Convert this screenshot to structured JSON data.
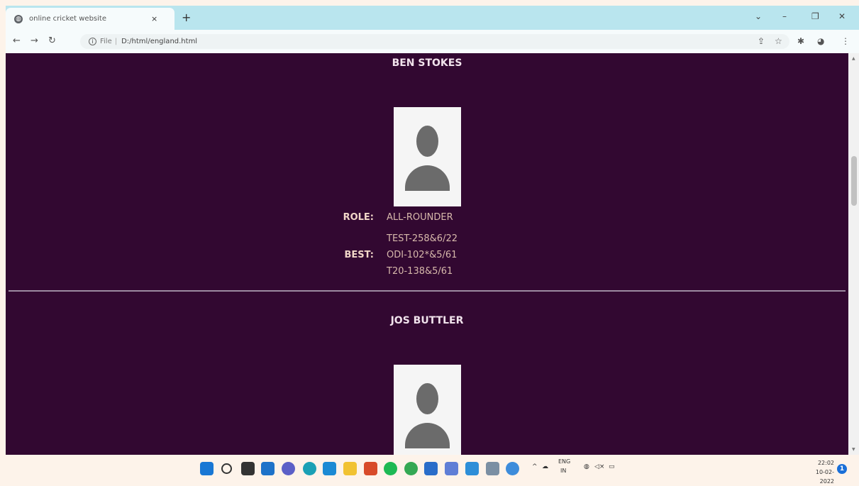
{
  "browser": {
    "tab_title": "online cricket website",
    "tab_close": "×",
    "new_tab": "+",
    "window_controls": {
      "list": "⌄",
      "minimize": "–",
      "maximize": "❐",
      "close": "✕"
    },
    "nav": {
      "back": "←",
      "forward": "→",
      "reload": "↻"
    },
    "url_scheme": "File",
    "url_sep": "|",
    "url": "D:/html/england.html",
    "toolbar_icons": [
      "share-icon",
      "star-icon",
      "extensions-icon",
      "profile-icon",
      "menu-icon"
    ],
    "menu": "⋮"
  },
  "players": [
    {
      "name": "BEN STOKES",
      "role_label": "ROLE:",
      "role": "ALL-ROUNDER",
      "best_label": "BEST:",
      "best": [
        "TEST-258&6/22",
        "ODI-102*&5/61",
        "T20-138&5/61"
      ]
    },
    {
      "name": "JOS BUTTLER"
    }
  ],
  "taskbar": {
    "tray": {
      "chevron": "^",
      "lang_top": "ENG",
      "lang_bottom": "IN"
    },
    "clock": {
      "time": "22:02",
      "date": "10-02-2022"
    },
    "notification_count": "1"
  },
  "colors": {
    "page_bg": "#320831",
    "tabbar_bg": "#b9e5ee",
    "label": "#f1d6c8",
    "value": "#d7b9ab",
    "divider": "#9c8aa0"
  }
}
